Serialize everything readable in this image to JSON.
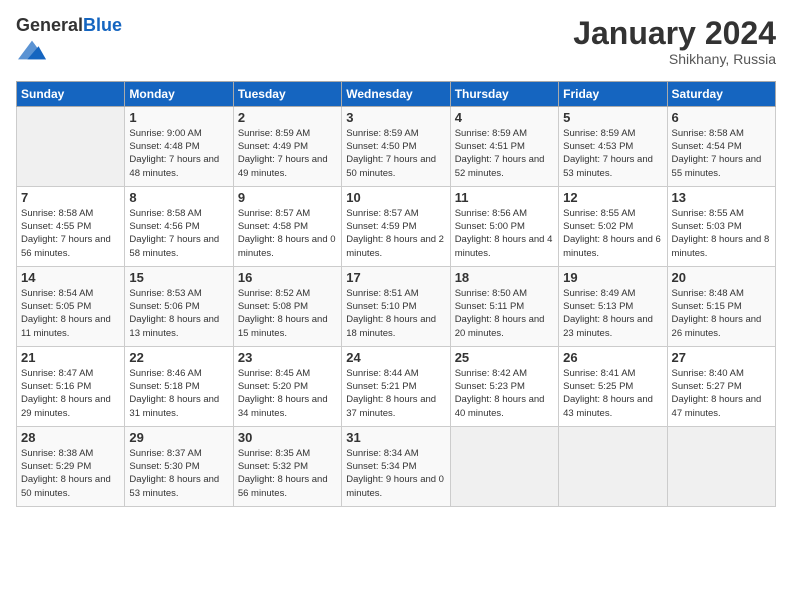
{
  "header": {
    "logo_general": "General",
    "logo_blue": "Blue",
    "month_title": "January 2024",
    "location": "Shikhany, Russia"
  },
  "days_of_week": [
    "Sunday",
    "Monday",
    "Tuesday",
    "Wednesday",
    "Thursday",
    "Friday",
    "Saturday"
  ],
  "weeks": [
    [
      {
        "day": "",
        "sunrise": "",
        "sunset": "",
        "daylight": ""
      },
      {
        "day": "1",
        "sunrise": "Sunrise: 9:00 AM",
        "sunset": "Sunset: 4:48 PM",
        "daylight": "Daylight: 7 hours and 48 minutes."
      },
      {
        "day": "2",
        "sunrise": "Sunrise: 8:59 AM",
        "sunset": "Sunset: 4:49 PM",
        "daylight": "Daylight: 7 hours and 49 minutes."
      },
      {
        "day": "3",
        "sunrise": "Sunrise: 8:59 AM",
        "sunset": "Sunset: 4:50 PM",
        "daylight": "Daylight: 7 hours and 50 minutes."
      },
      {
        "day": "4",
        "sunrise": "Sunrise: 8:59 AM",
        "sunset": "Sunset: 4:51 PM",
        "daylight": "Daylight: 7 hours and 52 minutes."
      },
      {
        "day": "5",
        "sunrise": "Sunrise: 8:59 AM",
        "sunset": "Sunset: 4:53 PM",
        "daylight": "Daylight: 7 hours and 53 minutes."
      },
      {
        "day": "6",
        "sunrise": "Sunrise: 8:58 AM",
        "sunset": "Sunset: 4:54 PM",
        "daylight": "Daylight: 7 hours and 55 minutes."
      }
    ],
    [
      {
        "day": "7",
        "sunrise": "Sunrise: 8:58 AM",
        "sunset": "Sunset: 4:55 PM",
        "daylight": "Daylight: 7 hours and 56 minutes."
      },
      {
        "day": "8",
        "sunrise": "Sunrise: 8:58 AM",
        "sunset": "Sunset: 4:56 PM",
        "daylight": "Daylight: 7 hours and 58 minutes."
      },
      {
        "day": "9",
        "sunrise": "Sunrise: 8:57 AM",
        "sunset": "Sunset: 4:58 PM",
        "daylight": "Daylight: 8 hours and 0 minutes."
      },
      {
        "day": "10",
        "sunrise": "Sunrise: 8:57 AM",
        "sunset": "Sunset: 4:59 PM",
        "daylight": "Daylight: 8 hours and 2 minutes."
      },
      {
        "day": "11",
        "sunrise": "Sunrise: 8:56 AM",
        "sunset": "Sunset: 5:00 PM",
        "daylight": "Daylight: 8 hours and 4 minutes."
      },
      {
        "day": "12",
        "sunrise": "Sunrise: 8:55 AM",
        "sunset": "Sunset: 5:02 PM",
        "daylight": "Daylight: 8 hours and 6 minutes."
      },
      {
        "day": "13",
        "sunrise": "Sunrise: 8:55 AM",
        "sunset": "Sunset: 5:03 PM",
        "daylight": "Daylight: 8 hours and 8 minutes."
      }
    ],
    [
      {
        "day": "14",
        "sunrise": "Sunrise: 8:54 AM",
        "sunset": "Sunset: 5:05 PM",
        "daylight": "Daylight: 8 hours and 11 minutes."
      },
      {
        "day": "15",
        "sunrise": "Sunrise: 8:53 AM",
        "sunset": "Sunset: 5:06 PM",
        "daylight": "Daylight: 8 hours and 13 minutes."
      },
      {
        "day": "16",
        "sunrise": "Sunrise: 8:52 AM",
        "sunset": "Sunset: 5:08 PM",
        "daylight": "Daylight: 8 hours and 15 minutes."
      },
      {
        "day": "17",
        "sunrise": "Sunrise: 8:51 AM",
        "sunset": "Sunset: 5:10 PM",
        "daylight": "Daylight: 8 hours and 18 minutes."
      },
      {
        "day": "18",
        "sunrise": "Sunrise: 8:50 AM",
        "sunset": "Sunset: 5:11 PM",
        "daylight": "Daylight: 8 hours and 20 minutes."
      },
      {
        "day": "19",
        "sunrise": "Sunrise: 8:49 AM",
        "sunset": "Sunset: 5:13 PM",
        "daylight": "Daylight: 8 hours and 23 minutes."
      },
      {
        "day": "20",
        "sunrise": "Sunrise: 8:48 AM",
        "sunset": "Sunset: 5:15 PM",
        "daylight": "Daylight: 8 hours and 26 minutes."
      }
    ],
    [
      {
        "day": "21",
        "sunrise": "Sunrise: 8:47 AM",
        "sunset": "Sunset: 5:16 PM",
        "daylight": "Daylight: 8 hours and 29 minutes."
      },
      {
        "day": "22",
        "sunrise": "Sunrise: 8:46 AM",
        "sunset": "Sunset: 5:18 PM",
        "daylight": "Daylight: 8 hours and 31 minutes."
      },
      {
        "day": "23",
        "sunrise": "Sunrise: 8:45 AM",
        "sunset": "Sunset: 5:20 PM",
        "daylight": "Daylight: 8 hours and 34 minutes."
      },
      {
        "day": "24",
        "sunrise": "Sunrise: 8:44 AM",
        "sunset": "Sunset: 5:21 PM",
        "daylight": "Daylight: 8 hours and 37 minutes."
      },
      {
        "day": "25",
        "sunrise": "Sunrise: 8:42 AM",
        "sunset": "Sunset: 5:23 PM",
        "daylight": "Daylight: 8 hours and 40 minutes."
      },
      {
        "day": "26",
        "sunrise": "Sunrise: 8:41 AM",
        "sunset": "Sunset: 5:25 PM",
        "daylight": "Daylight: 8 hours and 43 minutes."
      },
      {
        "day": "27",
        "sunrise": "Sunrise: 8:40 AM",
        "sunset": "Sunset: 5:27 PM",
        "daylight": "Daylight: 8 hours and 47 minutes."
      }
    ],
    [
      {
        "day": "28",
        "sunrise": "Sunrise: 8:38 AM",
        "sunset": "Sunset: 5:29 PM",
        "daylight": "Daylight: 8 hours and 50 minutes."
      },
      {
        "day": "29",
        "sunrise": "Sunrise: 8:37 AM",
        "sunset": "Sunset: 5:30 PM",
        "daylight": "Daylight: 8 hours and 53 minutes."
      },
      {
        "day": "30",
        "sunrise": "Sunrise: 8:35 AM",
        "sunset": "Sunset: 5:32 PM",
        "daylight": "Daylight: 8 hours and 56 minutes."
      },
      {
        "day": "31",
        "sunrise": "Sunrise: 8:34 AM",
        "sunset": "Sunset: 5:34 PM",
        "daylight": "Daylight: 9 hours and 0 minutes."
      },
      {
        "day": "",
        "sunrise": "",
        "sunset": "",
        "daylight": ""
      },
      {
        "day": "",
        "sunrise": "",
        "sunset": "",
        "daylight": ""
      },
      {
        "day": "",
        "sunrise": "",
        "sunset": "",
        "daylight": ""
      }
    ]
  ]
}
